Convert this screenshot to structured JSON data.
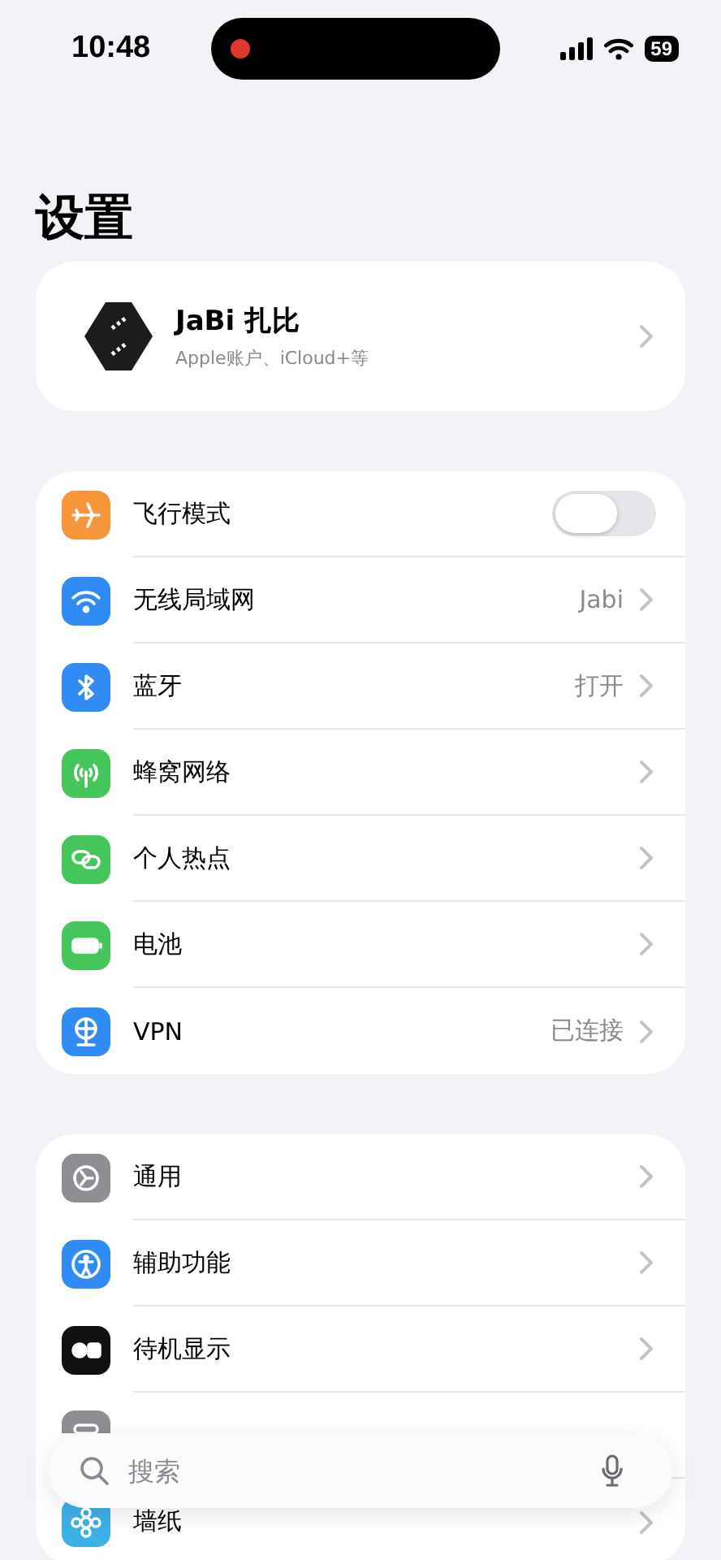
{
  "status_bar": {
    "time": "10:48",
    "battery": "59"
  },
  "title": "设置",
  "account": {
    "name": "JaBi 扎比",
    "subtitle": "Apple账户、iCloud+等"
  },
  "groups": [
    {
      "items": [
        {
          "kind": "toggle",
          "color": "#f7953a",
          "label": "飞行模式",
          "on": false
        },
        {
          "kind": "link",
          "color": "#2f8cf5",
          "label": "无线局域网",
          "value": "Jabi"
        },
        {
          "kind": "link",
          "color": "#2f8cf5",
          "label": "蓝牙",
          "value": "打开"
        },
        {
          "kind": "link",
          "color": "#45c65a",
          "label": "蜂窝网络"
        },
        {
          "kind": "link",
          "color": "#45c65a",
          "label": "个人热点"
        },
        {
          "kind": "link",
          "color": "#45c65a",
          "label": "电池"
        },
        {
          "kind": "link",
          "color": "#2f8cf5",
          "label": "VPN",
          "value": "已连接"
        }
      ]
    },
    {
      "items": [
        {
          "kind": "link",
          "color": "#8e8e93",
          "label": "通用"
        },
        {
          "kind": "link",
          "color": "#2f8cf5",
          "label": "辅助功能"
        },
        {
          "kind": "link",
          "color": "#111111",
          "label": "待机显示"
        },
        {
          "kind": "covered",
          "color": "#8e8e93"
        },
        {
          "kind": "link",
          "color": "#3db0e8",
          "label": "墙纸"
        }
      ]
    }
  ],
  "search": {
    "placeholder": "搜索"
  }
}
